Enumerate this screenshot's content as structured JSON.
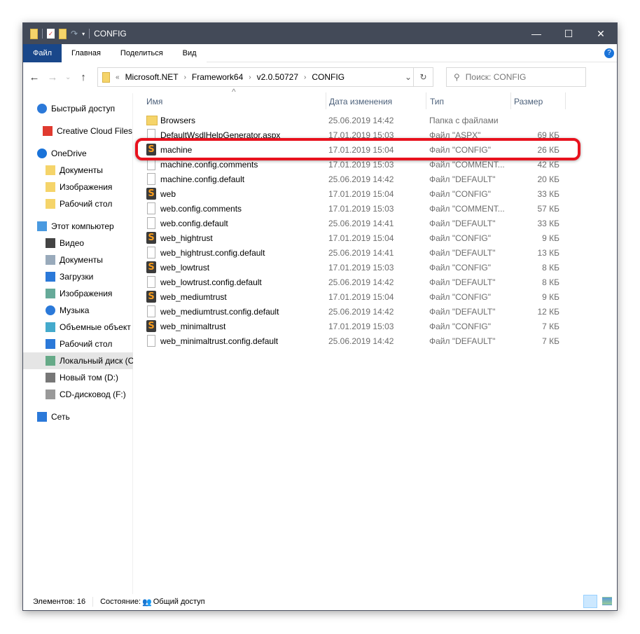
{
  "window": {
    "title": "CONFIG",
    "minimize": "—",
    "maximize": "☐",
    "close": "✕"
  },
  "ribbon": {
    "tabs": [
      "Файл",
      "Главная",
      "Поделиться",
      "Вид"
    ],
    "help": "?"
  },
  "nav": {
    "back": "←",
    "forward": "→",
    "recent": "⌄",
    "up": "↑",
    "breadcrumb": [
      "Microsoft.NET",
      "Framework64",
      "v2.0.50727",
      "CONFIG"
    ],
    "overflow": "«",
    "search_placeholder": "Поиск: CONFIG"
  },
  "sidebar": {
    "items": [
      {
        "label": "Быстрый доступ",
        "icon": "star-icon",
        "color": "#2b79d9"
      },
      {
        "label": "Creative Cloud Files",
        "icon": "creative-cloud-icon",
        "color": "#e03a2f"
      },
      {
        "label": "OneDrive",
        "icon": "cloud-icon",
        "color": "#1a73d9"
      },
      {
        "label": "Документы",
        "icon": "folder-icon",
        "color": "#f5d46a"
      },
      {
        "label": "Изображения",
        "icon": "folder-icon",
        "color": "#f5d46a"
      },
      {
        "label": "Рабочий стол",
        "icon": "folder-icon",
        "color": "#f5d46a"
      },
      {
        "label": "Этот компьютер",
        "icon": "computer-icon",
        "color": "#4a9ae0"
      },
      {
        "label": "Видео",
        "icon": "video-icon",
        "color": "#444"
      },
      {
        "label": "Документы",
        "icon": "documents-icon",
        "color": "#9ab"
      },
      {
        "label": "Загрузки",
        "icon": "downloads-icon",
        "color": "#2b79d9"
      },
      {
        "label": "Изображения",
        "icon": "pictures-icon",
        "color": "#6a9"
      },
      {
        "label": "Музыка",
        "icon": "music-icon",
        "color": "#2b79d9"
      },
      {
        "label": "Объемные объект",
        "icon": "3d-objects-icon",
        "color": "#4ac"
      },
      {
        "label": "Рабочий стол",
        "icon": "desktop-icon",
        "color": "#2b79d9"
      },
      {
        "label": "Локальный диск (C:)",
        "icon": "drive-icon",
        "color": "#6a8"
      },
      {
        "label": "Новый том (D:)",
        "icon": "drive-icon",
        "color": "#777"
      },
      {
        "label": "CD-дисковод (F:)",
        "icon": "cd-drive-icon",
        "color": "#999"
      },
      {
        "label": "Сеть",
        "icon": "network-icon",
        "color": "#2b79d9"
      }
    ]
  },
  "columns": {
    "name": "Имя",
    "date": "Дата изменения",
    "type": "Тип",
    "size": "Размер",
    "sort_indicator": "^"
  },
  "files": [
    {
      "name": "Browsers",
      "date": "25.06.2019 14:42",
      "type": "Папка с файлами",
      "size": "",
      "kind": "folder"
    },
    {
      "name": "DefaultWsdlHelpGenerator.aspx",
      "date": "17.01.2019 15:03",
      "type": "Файл \"ASPX\"",
      "size": "69 КБ",
      "kind": "doc"
    },
    {
      "name": "machine",
      "date": "17.01.2019 15:04",
      "type": "Файл \"CONFIG\"",
      "size": "26 КБ",
      "kind": "config"
    },
    {
      "name": "machine.config.comments",
      "date": "17.01.2019 15:03",
      "type": "Файл \"COMMENT...",
      "size": "42 КБ",
      "kind": "doc"
    },
    {
      "name": "machine.config.default",
      "date": "25.06.2019 14:42",
      "type": "Файл \"DEFAULT\"",
      "size": "20 КБ",
      "kind": "doc"
    },
    {
      "name": "web",
      "date": "17.01.2019 15:04",
      "type": "Файл \"CONFIG\"",
      "size": "33 КБ",
      "kind": "config"
    },
    {
      "name": "web.config.comments",
      "date": "17.01.2019 15:03",
      "type": "Файл \"COMMENT...",
      "size": "57 КБ",
      "kind": "doc"
    },
    {
      "name": "web.config.default",
      "date": "25.06.2019 14:41",
      "type": "Файл \"DEFAULT\"",
      "size": "33 КБ",
      "kind": "doc"
    },
    {
      "name": "web_hightrust",
      "date": "17.01.2019 15:04",
      "type": "Файл \"CONFIG\"",
      "size": "9 КБ",
      "kind": "config"
    },
    {
      "name": "web_hightrust.config.default",
      "date": "25.06.2019 14:41",
      "type": "Файл \"DEFAULT\"",
      "size": "13 КБ",
      "kind": "doc"
    },
    {
      "name": "web_lowtrust",
      "date": "17.01.2019 15:03",
      "type": "Файл \"CONFIG\"",
      "size": "8 КБ",
      "kind": "config"
    },
    {
      "name": "web_lowtrust.config.default",
      "date": "25.06.2019 14:42",
      "type": "Файл \"DEFAULT\"",
      "size": "8 КБ",
      "kind": "doc"
    },
    {
      "name": "web_mediumtrust",
      "date": "17.01.2019 15:04",
      "type": "Файл \"CONFIG\"",
      "size": "9 КБ",
      "kind": "config"
    },
    {
      "name": "web_mediumtrust.config.default",
      "date": "25.06.2019 14:42",
      "type": "Файл \"DEFAULT\"",
      "size": "12 КБ",
      "kind": "doc"
    },
    {
      "name": "web_minimaltrust",
      "date": "17.01.2019 15:03",
      "type": "Файл \"CONFIG\"",
      "size": "7 КБ",
      "kind": "config"
    },
    {
      "name": "web_minimaltrust.config.default",
      "date": "25.06.2019 14:42",
      "type": "Файл \"DEFAULT\"",
      "size": "7 КБ",
      "kind": "doc"
    }
  ],
  "config_glyph": "S",
  "status": {
    "items": "Элементов: 16",
    "state": "Состояние:",
    "share": "Общий доступ"
  },
  "highlight_color": "#e8121e"
}
